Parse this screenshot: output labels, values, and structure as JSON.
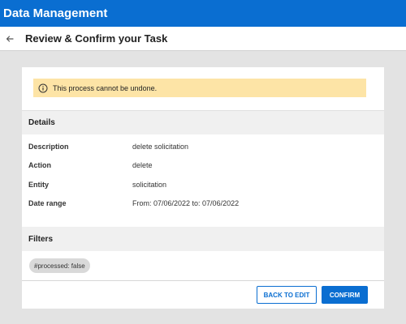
{
  "app": {
    "title": "Data Management"
  },
  "page": {
    "title": "Review & Confirm your Task"
  },
  "warning": {
    "text": "This process cannot be undone."
  },
  "details": {
    "header": "Details",
    "rows": [
      {
        "label": "Description",
        "value": "delete solicitation"
      },
      {
        "label": "Action",
        "value": "delete"
      },
      {
        "label": "Entity",
        "value": "solicitation"
      },
      {
        "label": "Date range",
        "value": "From: 07/06/2022 to: 07/06/2022"
      }
    ]
  },
  "filters": {
    "header": "Filters",
    "chips": [
      "#processed: false"
    ]
  },
  "actions": {
    "back_label": "BACK TO EDIT",
    "confirm_label": "CONFIRM"
  },
  "colors": {
    "primary": "#0a6ed1",
    "warning_bg": "#fde4a6",
    "page_bg": "#e3e3e3"
  },
  "icons": {
    "back": "arrow-left-icon",
    "warning": "info-circle-icon"
  }
}
